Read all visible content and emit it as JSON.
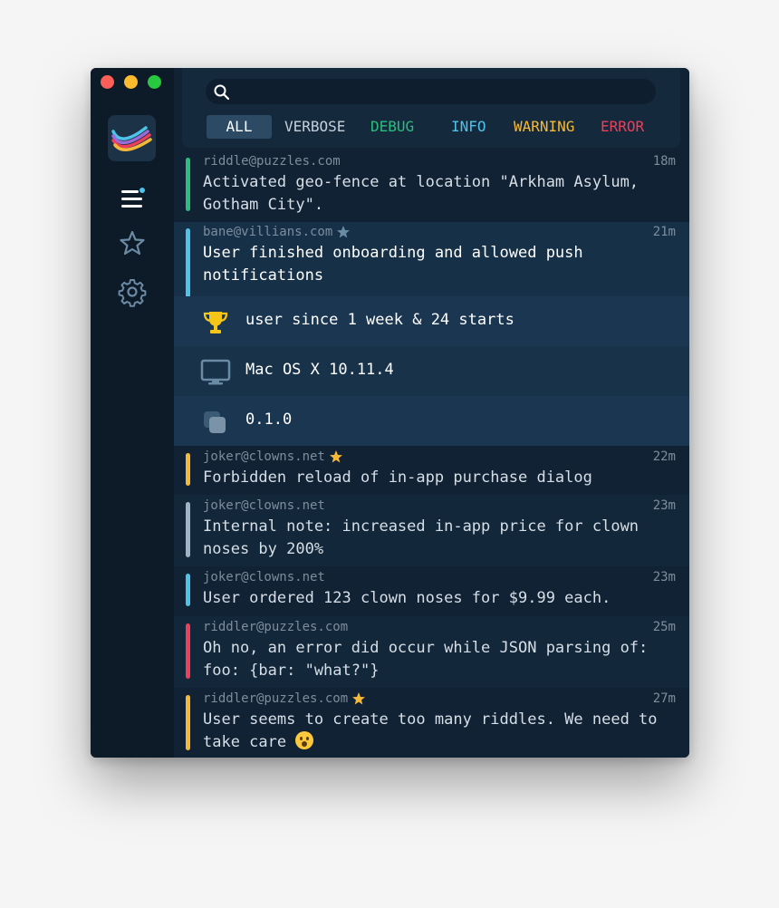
{
  "filters": [
    "ALL",
    "VERBOSE",
    "DEBUG",
    "INFO",
    "WARNING",
    "ERROR"
  ],
  "search": {
    "placeholder": ""
  },
  "entries": [
    {
      "user": "riddle@puzzles.com",
      "time": "18m",
      "message": "Activated geo-fence at location \"Arkham Asylum,\nGotham City\".",
      "starred": false
    },
    {
      "user": "bane@villians.com",
      "time": "21m",
      "message": "User finished onboarding and allowed push\nnotifications",
      "starred": true,
      "details": [
        {
          "icon": "trophy-icon",
          "text": "user since 1 week & 24 starts"
        },
        {
          "icon": "monitor-icon",
          "text": "Mac OS X 10.11.4"
        },
        {
          "icon": "version-icon",
          "text": "0.1.0"
        }
      ]
    },
    {
      "user": "joker@clowns.net",
      "time": "22m",
      "message": "Forbidden reload of in-app purchase dialog",
      "starred": true
    },
    {
      "user": "joker@clowns.net",
      "time": "23m",
      "message": "Internal note: increased in-app price for clown\nnoses by 200%",
      "starred": false
    },
    {
      "user": "joker@clowns.net",
      "time": "23m",
      "message": "User ordered 123 clown noses for $9.99 each.",
      "starred": false
    },
    {
      "user": "riddler@puzzles.com",
      "time": "25m",
      "message": "Oh no, an error did occur while JSON parsing of:\nfoo: {bar: \"what?\"}",
      "starred": false
    },
    {
      "user": "riddler@puzzles.com",
      "time": "27m",
      "message": "User seems to create too many riddles. We need to\ntake care",
      "starred": true
    }
  ],
  "colors": {
    "debug": "#2bbd7e",
    "info": "#4ec3ea",
    "verbose": "#9fb3c2",
    "warning": "#f5b93a",
    "error": "#eb3f5a",
    "star": "#f5b93a"
  }
}
